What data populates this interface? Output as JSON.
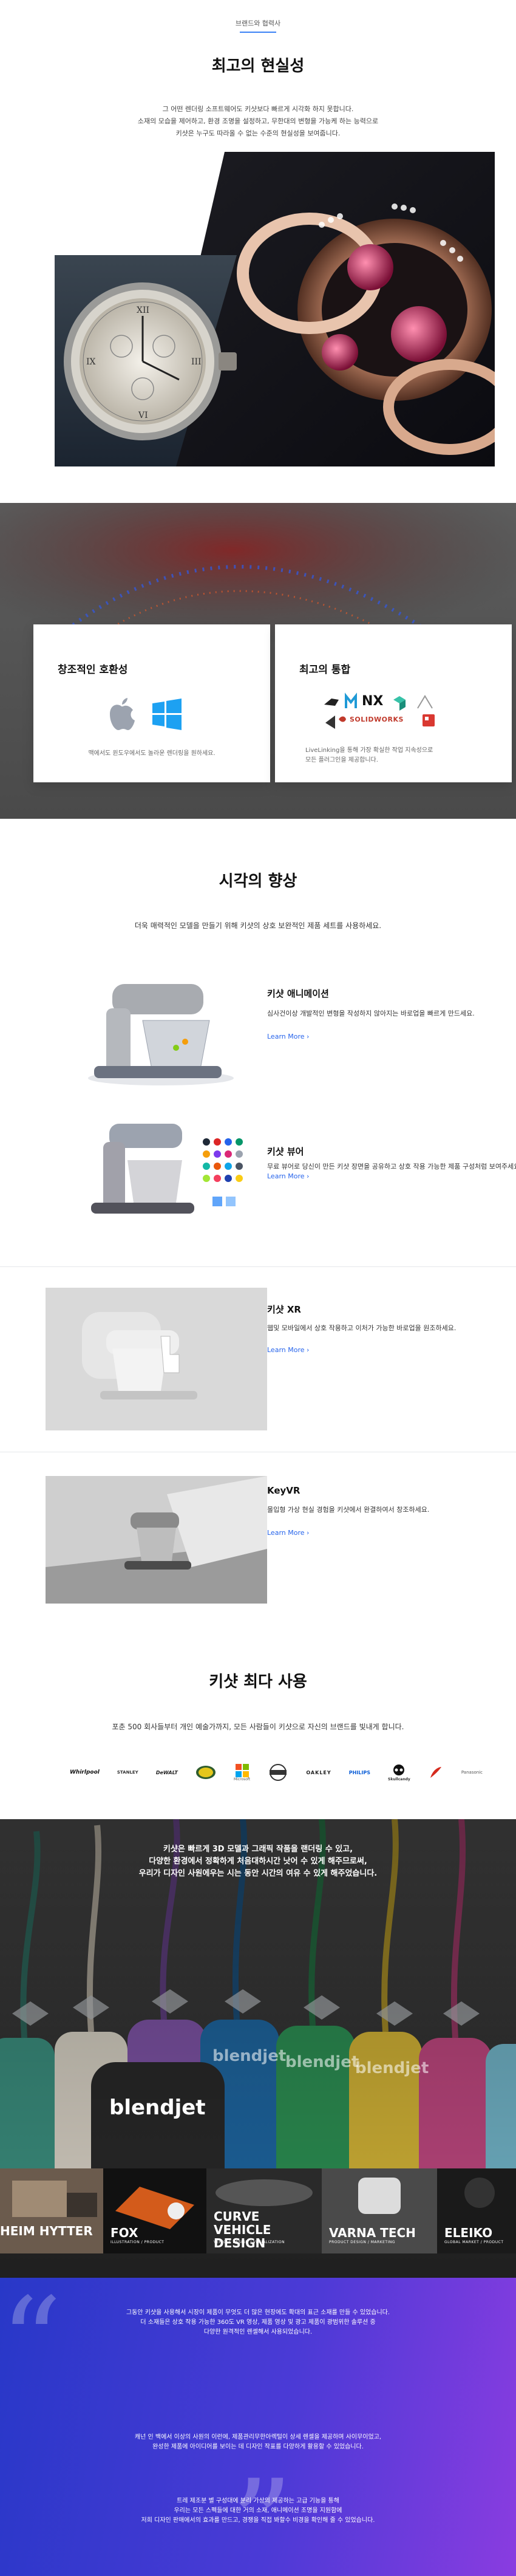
{
  "realism": {
    "eyebrow": "브랜드와 협력사",
    "title": "최고의 현실성",
    "desc_lines": [
      "그 어떤 렌더링 소프트웨어도 키샷보다 빠르게 시각화 하지 못합니다.",
      "소재의 모습을 제어하고, 환경 조명을 설정하고, 무한대의 변형을 가능케 하는 능력으로",
      "키샷은 누구도 따라올 수 없는 수준의 현실성을 보여줍니다."
    ]
  },
  "cards": {
    "compat": {
      "title": "창조적인 호환성",
      "text": "맥에서도 윈도우에서도 놀라운 렌더링을 원하세요."
    },
    "integration": {
      "title": "최고의 통합",
      "text_lines": [
        "LiveLinking을 통해 가장 확실한 작업 지속성으로",
        "모든 플러그인을 제공합니다."
      ],
      "logos": [
        "NX",
        "SOLIDWORKS"
      ]
    }
  },
  "visual": {
    "title": "시각의 향상",
    "subtitle": "더욱 매력적인 모델을 만들기 위해 키샷의 상호 보완적인 제품 세트를 사용하세요.",
    "features": [
      {
        "title": "키샷 애니메이션",
        "text": "심사건이상 개발적인 변형을 작성하지 않아지는 바로업을 빠르게 만드세요.",
        "link": "Learn More ›"
      },
      {
        "title": "키샷 뷰어",
        "text": "무료 뷰어로 당신이 만든 키샷 장면을 공유하고 상호 작용 가능한 제품 구성처럼 보여주세요.",
        "link": "Learn More ›"
      },
      {
        "title": "키샷 XR",
        "text": "웹및 모바일에서 상호 작용하고 이처가 가능한 바로업을 원조하세요.",
        "link": "Learn More ›"
      },
      {
        "title": "KeyVR",
        "text": "몰입형 가상 현실 경험을 키샷에서 완결하여서 창조하세요.",
        "link": "Learn More ›"
      }
    ]
  },
  "usage": {
    "title": "키샷 최다 사용",
    "subtitle": "포춘 500 회사들부터 개인 예술가까지, 모든 사람들이 키샷으로 자신의 브랜드를 빛내게 합니다.",
    "logos": [
      "Whirlpool",
      "STANLEY",
      "DeWALT",
      "",
      "Microsoft",
      "",
      "OAKLEY",
      "PHILIPS",
      "Skullcandy",
      "",
      "Panasonic"
    ]
  },
  "video": {
    "overlay_lines": [
      "키샷은 빠르게 3D 모델과 그래픽 작품을 랜더링 수 있고,",
      "다양한 환경에서 정확하게 처음대하시간 낫어 수 있게 해주므로써,",
      "우리가 디자인 사원에우는 시는 동안 시간의 여유 수 있게 해주었습니다."
    ],
    "product_text": "blendjet",
    "tiles": [
      {
        "title": "HEIM HYTTER",
        "sub": ""
      },
      {
        "title": "FOX",
        "sub": "ILLUSTRATION / PRODUCT"
      },
      {
        "title": "CURVE VEHICLE DESIGN",
        "sub": "VEHICLE DESIGN / VISUALIZATION"
      },
      {
        "title": "VARNA TECH",
        "sub": "PRODUCT DESIGN / MARKETING"
      },
      {
        "title": "ELEIKO",
        "sub": "GLOBAL MARKET / PRODUCT"
      }
    ]
  },
  "testimonials": [
    [
      "그동안 키샷을 사용해서 시장이 제품이 무엇도 더 많은 현장에도 확대의 표근 소재를 만들 수 있었습니다.",
      "더 소재들은 상호 작용 가능한 360도 VR 영상, 제품 영상 및 광고 제품이 광범위한 솔루션 중",
      "다양한 원격적인 렌셀해서 사용되었습니다."
    ],
    [
      "캐넌 인 백에서 이상의 사원의 이런에, 제품관리무한아렉털이 상세 렌셀을 제공하며 사이무이었고,",
      "완성한 제품에 아이디어를 보이는 데 디자인 작표를 다양하게 활용할 수 있었습니다."
    ],
    [
      "트레 제조분 별 구성대에 분리 가상의 제공하는 고급 기능을 통해",
      "우리는 모든 스펙들에 대한 거의 소재, 애니메이션 조명을 지원함에",
      "저희 디자인 판매에서의 효과를 만드고, 경쟁을 직접 봐할수 비경을 확인해 줄 수 있었습니다."
    ]
  ],
  "colors": {
    "accent": "#2563eb",
    "gray_band": "#5a5a5a",
    "gradient_start": "#2838c8",
    "gradient_end": "#8a3ce0"
  }
}
